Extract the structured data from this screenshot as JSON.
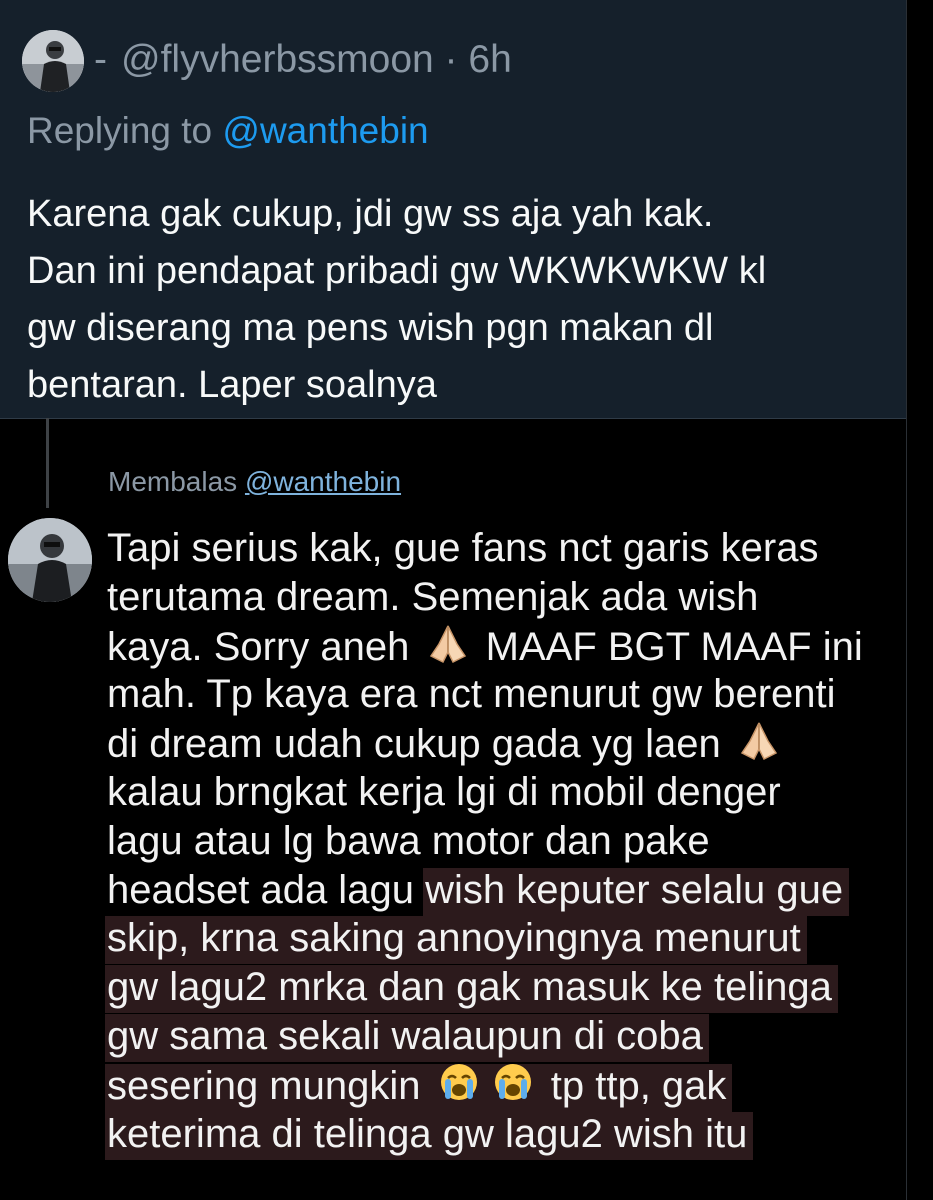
{
  "top_tweet": {
    "display_name": "-",
    "handle": "@flyvherbssmoon",
    "time": "6h",
    "replying_to_label": "Replying to",
    "replying_to_handle": "@wanthebin",
    "body_lines": [
      "Karena gak cukup, jdi gw ss aja yah kak.",
      "Dan ini pendapat pribadi gw WKWKWKW kl",
      "gw diserang ma pens wish pgn makan dl",
      "bentaran. Laper soalnya"
    ]
  },
  "screenshot_reply": {
    "membalas_label": "Membalas",
    "membalas_handle": "@wanthebin",
    "lines": {
      "l1": "Tapi serius kak, gue fans nct garis keras",
      "l2": "terutama dream. Semenjak ada wish",
      "l3a": "kaya. Sorry aneh",
      "l3b": "MAAF BGT MAAF ini",
      "l4": "mah. Tp kaya era nct menurut gw berenti",
      "l5": "di dream udah cukup gada yg laen",
      "l6": "kalau brngkat kerja lgi di mobil denger",
      "l7": "lagu atau lg bawa motor dan pake",
      "l8a": "headset ada lagu",
      "l8b": "wish keputer selalu gue",
      "l9": "skip, krna saking annoyingnya menurut",
      "l10": "gw lagu2 mrka dan gak masuk ke telinga",
      "l11": "gw sama sekali walaupun di coba",
      "l12a": "sesering mungkin",
      "l12b": "tp ttp, gak",
      "l13": "keterima di telinga gw lagu2 wish itu"
    },
    "emojis": {
      "pray": "folded-hands",
      "cry": "loudly-crying-face"
    },
    "highlight_color": "#2c1a1c"
  }
}
